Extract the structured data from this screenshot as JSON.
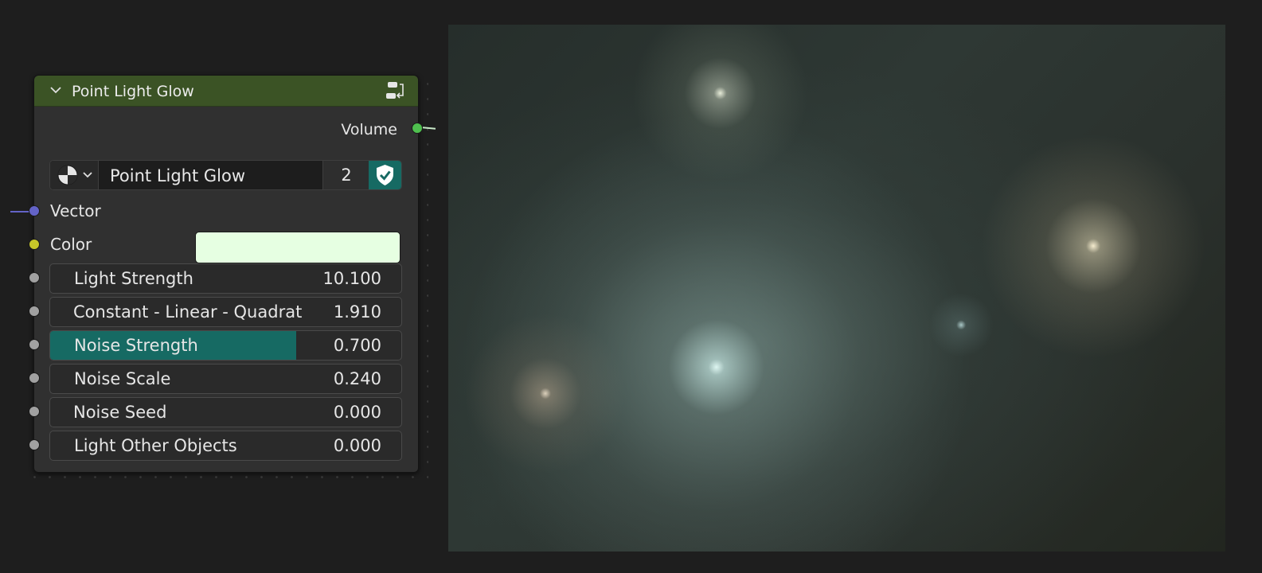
{
  "node": {
    "title": "Point Light Glow",
    "header_color": "#3b5325",
    "output": {
      "label": "Volume",
      "socket_color": "#4fc04f"
    },
    "datablock": {
      "name": "Point Light Glow",
      "users": "2",
      "browse_icon": "node-tree-icon",
      "fake_user_icon": "shield-check-icon"
    },
    "inputs": {
      "vector": {
        "label": "Vector",
        "socket_color": "#6363c7"
      },
      "color": {
        "label": "Color",
        "socket_color": "#c7c729",
        "value_color": "#e6ffe2"
      }
    },
    "fields": [
      {
        "label": "Light Strength",
        "value": "10.100",
        "fill": 0
      },
      {
        "label": "Constant - Linear - Quadrat",
        "value": "1.910",
        "fill": 0
      },
      {
        "label": "Noise Strength",
        "value": "0.700",
        "fill": 0.7
      },
      {
        "label": "Noise Scale",
        "value": "0.240",
        "fill": 0
      },
      {
        "label": "Noise Seed",
        "value": "0.000",
        "fill": 0
      },
      {
        "label": "Light Other Objects",
        "value": "0.000",
        "fill": 0
      }
    ]
  },
  "colors": {
    "accent": "#166a63",
    "float_socket": "#a1a1a1"
  },
  "viewer": {
    "description_icon": "render-preview"
  }
}
